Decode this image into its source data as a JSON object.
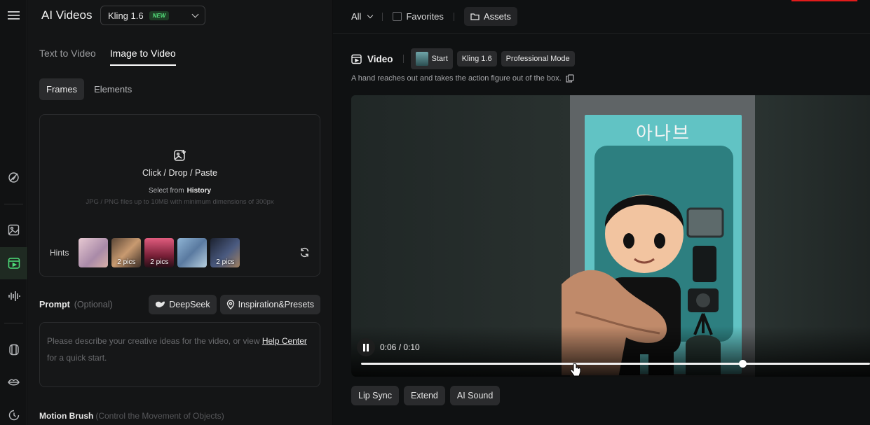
{
  "rail": {
    "icons": [
      "menu-icon",
      "effects-icon",
      "image-icon",
      "video-icon",
      "audio-icon",
      "avatar-icon",
      "lips-icon",
      "history-icon"
    ]
  },
  "header": {
    "title": "AI Videos",
    "model": "Kling 1.6",
    "model_badge": "NEW"
  },
  "tabs": [
    "Text to Video",
    "Image to Video"
  ],
  "subtabs": [
    "Frames",
    "Elements"
  ],
  "upload": {
    "main_text": "Click / Drop / Paste",
    "select_from": "Select from",
    "history_link": "History",
    "spec": "JPG / PNG files up to 10MB with minimum dimensions of 300px",
    "hints_label": "Hints",
    "hints": [
      {
        "count": "",
        "color": "#c9a9b8"
      },
      {
        "count": "2 pics",
        "color": "#8a6a55"
      },
      {
        "count": "2 pics",
        "color": "#c05070"
      },
      {
        "count": "",
        "color": "#7a9ab8"
      },
      {
        "count": "2 pics",
        "color": "#3a4560"
      }
    ]
  },
  "prompt": {
    "label": "Prompt",
    "optional": "(Optional)",
    "deepseek": "DeepSeek",
    "inspiration": "Inspiration&Presets",
    "placeholder_a": "Please describe your creative ideas for the video, or view",
    "help_link": "Help Center",
    "placeholder_b": "for a quick start."
  },
  "motion": {
    "label": "Motion Brush",
    "sub": "(Control the Movement of Objects)"
  },
  "topbar": {
    "filter": "All",
    "favorites": "Favorites",
    "assets": "Assets"
  },
  "video": {
    "heading": "Video",
    "chip_start": "Start",
    "chip_model": "Kling 1.6",
    "chip_mode": "Professional Mode",
    "description": "A hand reaches out and takes the action figure out of the box.",
    "box_title": "아나브",
    "time": "0:06 / 0:10",
    "progress": 0.6
  },
  "actions": [
    "Lip Sync",
    "Extend",
    "AI Sound"
  ],
  "colors": {
    "accent": "#4ee07a",
    "panel": "#141516",
    "box_teal": "#61c3c4"
  }
}
